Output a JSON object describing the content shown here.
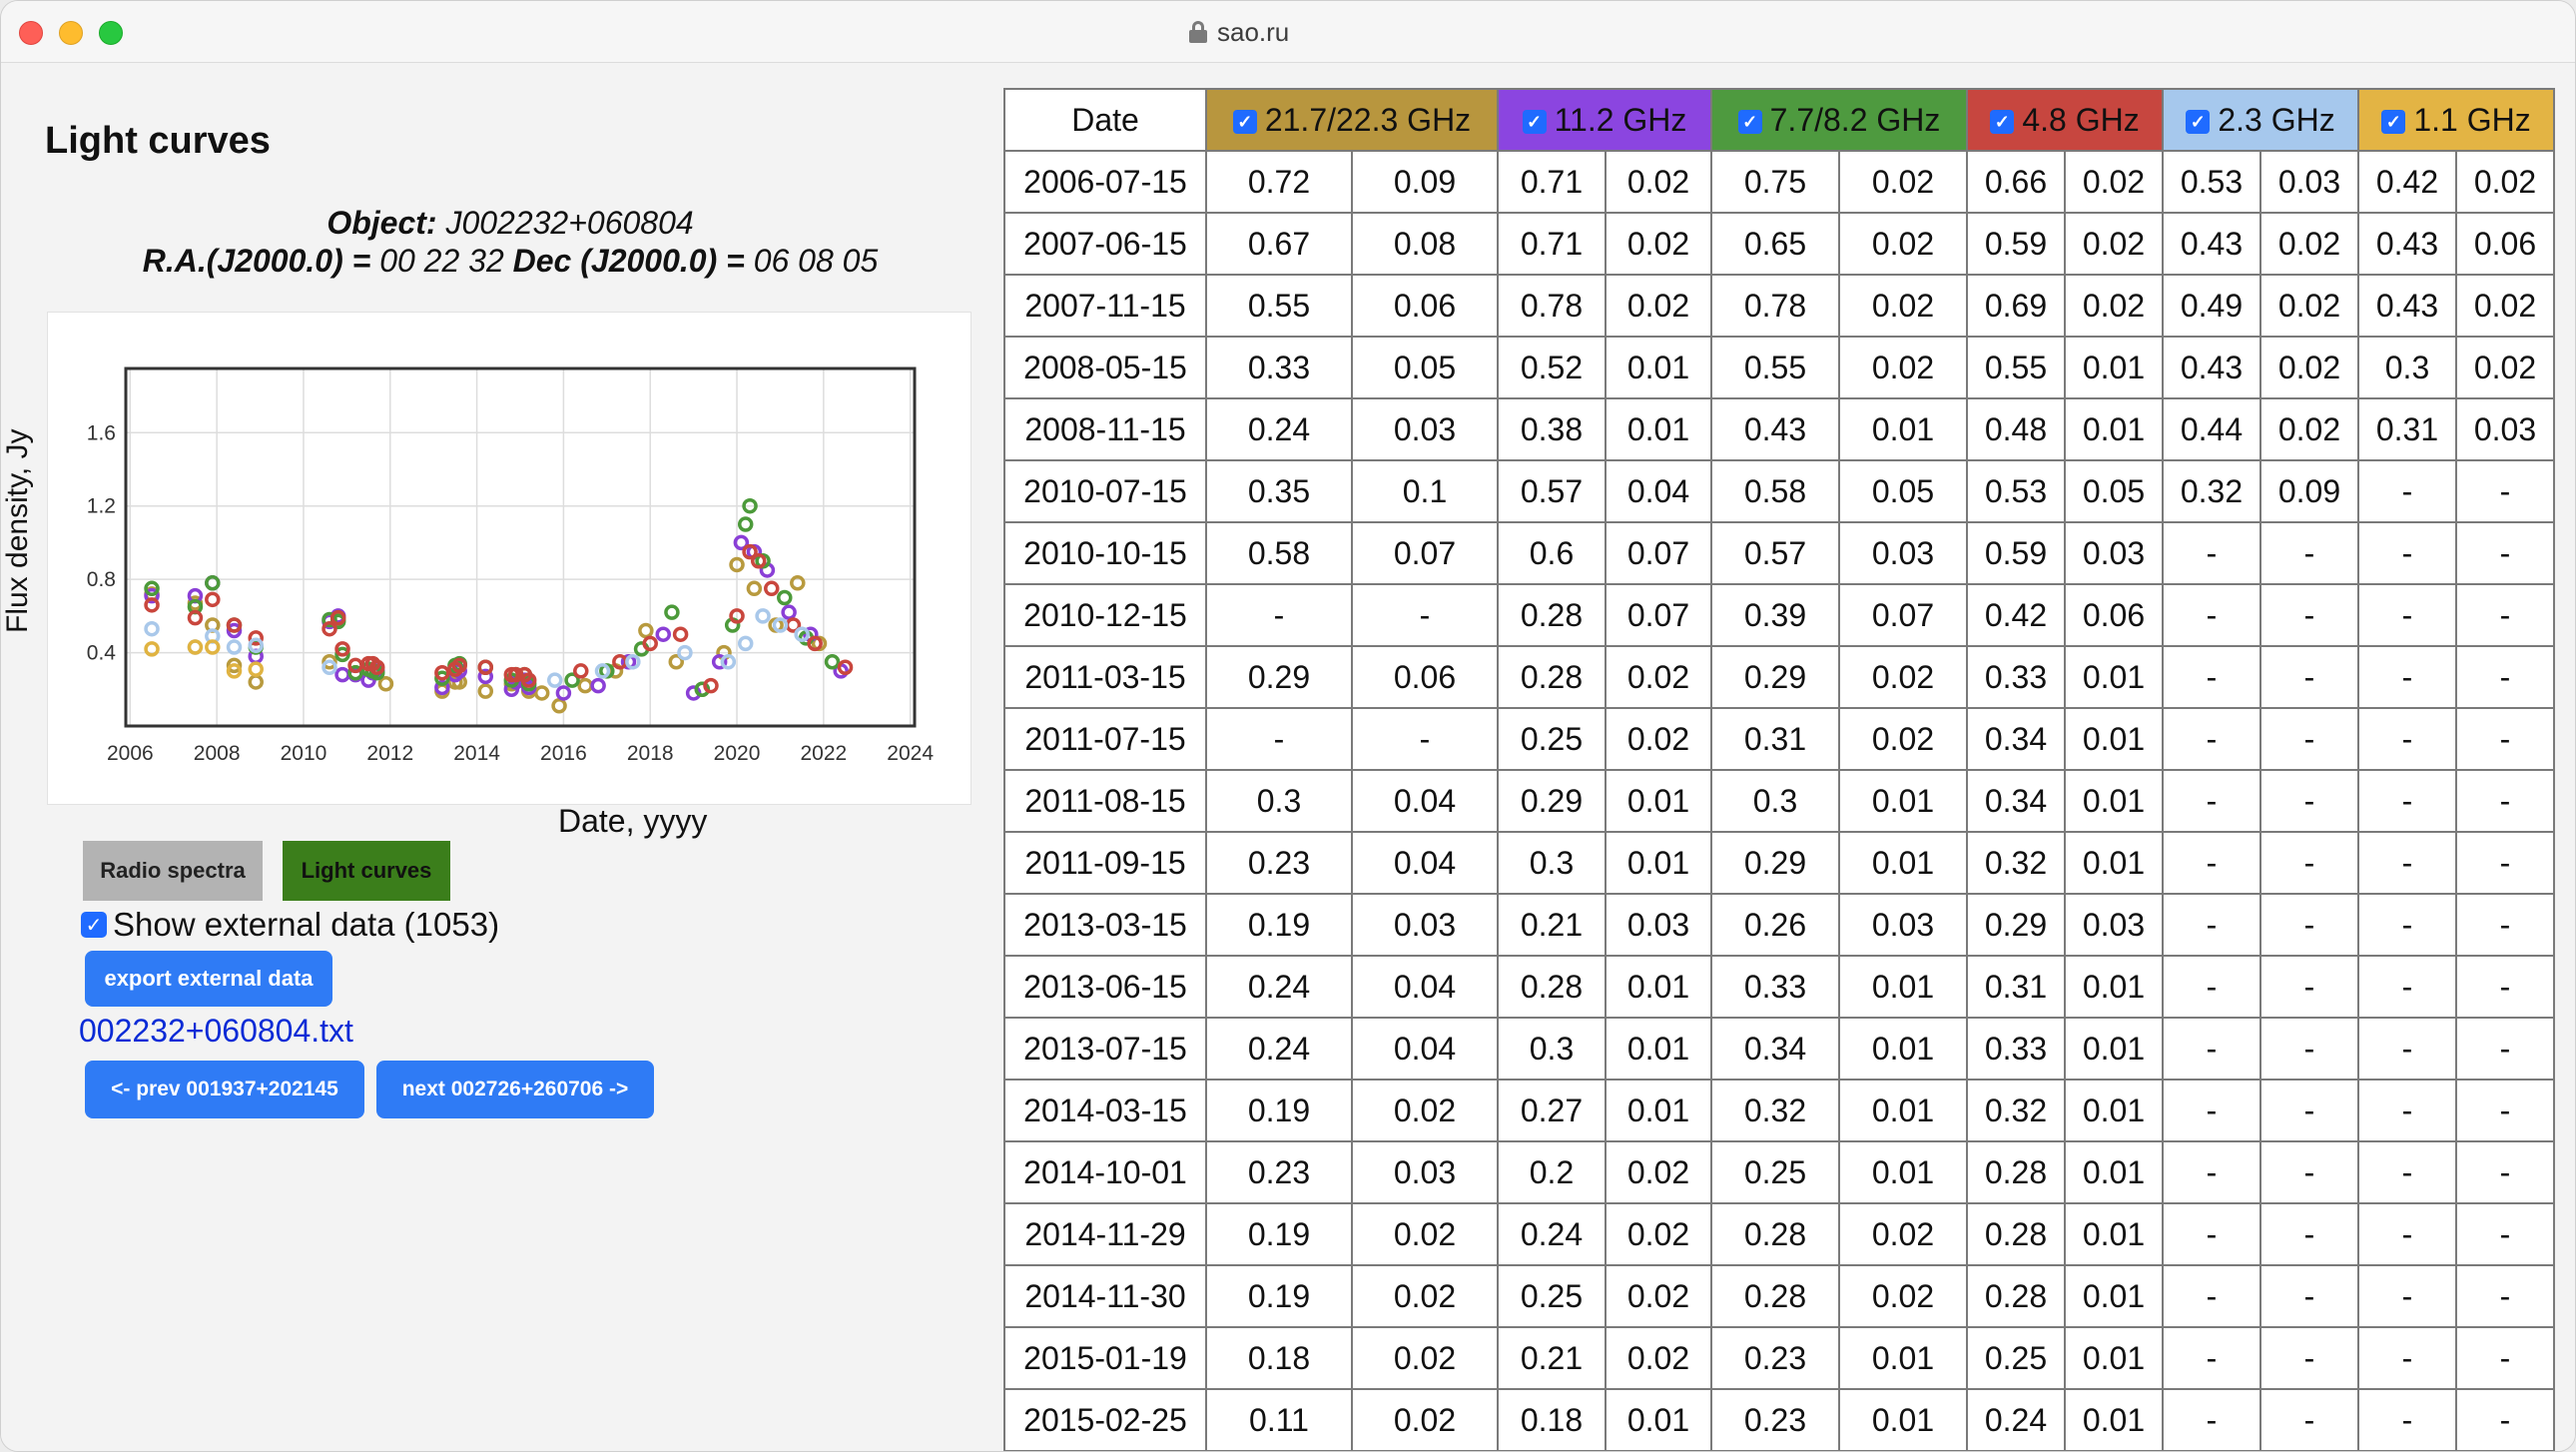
{
  "browser": {
    "url": "sao.ru"
  },
  "page": {
    "title": "Light curves",
    "object_label": "Object:",
    "object_name": "J002232+060804",
    "ra_label": "R.A.(J2000.0) =",
    "ra_value": "00 22 32",
    "dec_label": "Dec (J2000.0) =",
    "dec_value": "06 08 05"
  },
  "controls": {
    "radio_spectra": "Radio spectra",
    "light_curves": "Light curves",
    "show_external": "Show external data (1053)",
    "export": "export external data",
    "file_link": "002232+060804.txt",
    "prev": "<- prev 001937+202145",
    "next": "next 002726+260706 ->"
  },
  "chart_data": {
    "type": "scatter",
    "xlabel": "Date, yyyy",
    "ylabel": "Flux density, Jy",
    "xlim": [
      2005.9,
      2024.1
    ],
    "ylim": [
      0.0,
      1.95
    ],
    "xticks": [
      2006,
      2008,
      2010,
      2012,
      2014,
      2016,
      2018,
      2020,
      2022,
      2024
    ],
    "yticks": [
      0.4,
      0.8,
      1.2,
      1.6
    ],
    "grid": true,
    "series": [
      {
        "name": "21.7/22.3 GHz",
        "color": "#b89a3e",
        "x": [
          2006.5,
          2007.5,
          2007.9,
          2008.4,
          2008.9,
          2010.6,
          2010.8,
          2011.2,
          2011.6,
          2011.9,
          2013.2,
          2013.5,
          2013.6,
          2014.2,
          2014.8,
          2015.2,
          2015.5,
          2015.9,
          2016.5,
          2017.2,
          2017.9,
          2018.6,
          2019.2,
          2019.7,
          2020.0,
          2020.4,
          2020.9,
          2021.4,
          2021.9
        ],
        "y": [
          0.72,
          0.67,
          0.55,
          0.33,
          0.24,
          0.35,
          0.58,
          0.29,
          0.3,
          0.23,
          0.19,
          0.24,
          0.24,
          0.19,
          0.23,
          0.19,
          0.18,
          0.11,
          0.22,
          0.3,
          0.52,
          0.35,
          0.2,
          0.4,
          0.88,
          0.75,
          0.55,
          0.78,
          0.45
        ]
      },
      {
        "name": "11.2 GHz",
        "color": "#8a3fd6",
        "x": [
          2006.5,
          2007.5,
          2007.9,
          2008.4,
          2008.9,
          2010.6,
          2010.8,
          2010.9,
          2011.2,
          2011.5,
          2011.6,
          2011.7,
          2013.2,
          2013.5,
          2013.6,
          2014.2,
          2014.8,
          2014.9,
          2015.1,
          2015.2,
          2016.0,
          2016.8,
          2017.5,
          2018.3,
          2019.0,
          2019.6,
          2020.1,
          2020.4,
          2020.7,
          2021.2,
          2021.7,
          2022.4
        ],
        "y": [
          0.71,
          0.71,
          0.78,
          0.52,
          0.38,
          0.57,
          0.6,
          0.28,
          0.28,
          0.25,
          0.29,
          0.3,
          0.21,
          0.28,
          0.3,
          0.27,
          0.2,
          0.24,
          0.25,
          0.21,
          0.18,
          0.22,
          0.35,
          0.5,
          0.18,
          0.35,
          1.0,
          0.95,
          0.85,
          0.62,
          0.5,
          0.3
        ]
      },
      {
        "name": "7.7/8.2 GHz",
        "color": "#4c9a3a",
        "x": [
          2006.5,
          2007.5,
          2007.9,
          2008.4,
          2008.9,
          2010.6,
          2010.8,
          2010.9,
          2011.2,
          2011.5,
          2011.6,
          2011.7,
          2013.2,
          2013.5,
          2013.6,
          2014.2,
          2014.8,
          2014.9,
          2015.1,
          2015.2,
          2016.2,
          2017.0,
          2017.8,
          2018.5,
          2019.2,
          2019.9,
          2020.2,
          2020.3,
          2020.6,
          2021.1,
          2021.6,
          2022.2
        ],
        "y": [
          0.75,
          0.65,
          0.78,
          0.55,
          0.43,
          0.58,
          0.57,
          0.39,
          0.29,
          0.31,
          0.3,
          0.29,
          0.26,
          0.33,
          0.34,
          0.32,
          0.25,
          0.28,
          0.28,
          0.23,
          0.25,
          0.3,
          0.42,
          0.62,
          0.2,
          0.55,
          1.1,
          1.2,
          0.9,
          0.7,
          0.48,
          0.35
        ]
      },
      {
        "name": "4.8 GHz",
        "color": "#c9463d",
        "x": [
          2006.5,
          2007.5,
          2007.9,
          2008.4,
          2008.9,
          2010.6,
          2010.8,
          2010.9,
          2011.2,
          2011.5,
          2011.6,
          2011.7,
          2013.2,
          2013.5,
          2013.6,
          2014.2,
          2014.8,
          2014.9,
          2015.1,
          2015.2,
          2016.4,
          2017.3,
          2018.0,
          2018.7,
          2019.4,
          2020.0,
          2020.3,
          2020.5,
          2020.8,
          2021.3,
          2021.8,
          2022.5
        ],
        "y": [
          0.66,
          0.59,
          0.69,
          0.55,
          0.48,
          0.53,
          0.59,
          0.42,
          0.33,
          0.34,
          0.34,
          0.32,
          0.29,
          0.31,
          0.33,
          0.32,
          0.28,
          0.28,
          0.28,
          0.25,
          0.3,
          0.35,
          0.45,
          0.5,
          0.22,
          0.6,
          0.95,
          0.9,
          0.75,
          0.55,
          0.45,
          0.32
        ]
      },
      {
        "name": "2.3 GHz",
        "color": "#a9c8ea",
        "x": [
          2006.5,
          2007.5,
          2007.9,
          2008.4,
          2008.9,
          2010.6,
          2015.8,
          2016.9,
          2017.6,
          2018.8,
          2019.8,
          2020.2,
          2020.6,
          2021.0,
          2021.5
        ],
        "y": [
          0.53,
          0.43,
          0.49,
          0.43,
          0.44,
          0.32,
          0.25,
          0.3,
          0.35,
          0.4,
          0.35,
          0.45,
          0.6,
          0.55,
          0.5
        ]
      },
      {
        "name": "1.1 GHz",
        "color": "#e0b341",
        "x": [
          2006.5,
          2007.5,
          2007.9,
          2008.4,
          2008.9
        ],
        "y": [
          0.42,
          0.43,
          0.43,
          0.3,
          0.31
        ]
      }
    ]
  },
  "table": {
    "date_header": "Date",
    "bands": [
      {
        "label": "21.7/22.3 GHz",
        "color": "#b8963e"
      },
      {
        "label": "11.2 GHz",
        "color": "#8b45e0"
      },
      {
        "label": "7.7/8.2 GHz",
        "color": "#4e9a3f"
      },
      {
        "label": "4.8 GHz",
        "color": "#c7463f"
      },
      {
        "label": "2.3 GHz",
        "color": "#a6c8ed"
      },
      {
        "label": "1.1 GHz",
        "color": "#e3b444"
      }
    ],
    "rows": [
      [
        "2006-07-15",
        "0.72",
        "0.09",
        "0.71",
        "0.02",
        "0.75",
        "0.02",
        "0.66",
        "0.02",
        "0.53",
        "0.03",
        "0.42",
        "0.02"
      ],
      [
        "2007-06-15",
        "0.67",
        "0.08",
        "0.71",
        "0.02",
        "0.65",
        "0.02",
        "0.59",
        "0.02",
        "0.43",
        "0.02",
        "0.43",
        "0.06"
      ],
      [
        "2007-11-15",
        "0.55",
        "0.06",
        "0.78",
        "0.02",
        "0.78",
        "0.02",
        "0.69",
        "0.02",
        "0.49",
        "0.02",
        "0.43",
        "0.02"
      ],
      [
        "2008-05-15",
        "0.33",
        "0.05",
        "0.52",
        "0.01",
        "0.55",
        "0.02",
        "0.55",
        "0.01",
        "0.43",
        "0.02",
        "0.3",
        "0.02"
      ],
      [
        "2008-11-15",
        "0.24",
        "0.03",
        "0.38",
        "0.01",
        "0.43",
        "0.01",
        "0.48",
        "0.01",
        "0.44",
        "0.02",
        "0.31",
        "0.03"
      ],
      [
        "2010-07-15",
        "0.35",
        "0.1",
        "0.57",
        "0.04",
        "0.58",
        "0.05",
        "0.53",
        "0.05",
        "0.32",
        "0.09",
        "-",
        "-"
      ],
      [
        "2010-10-15",
        "0.58",
        "0.07",
        "0.6",
        "0.07",
        "0.57",
        "0.03",
        "0.59",
        "0.03",
        "-",
        "-",
        "-",
        "-"
      ],
      [
        "2010-12-15",
        "-",
        "-",
        "0.28",
        "0.07",
        "0.39",
        "0.07",
        "0.42",
        "0.06",
        "-",
        "-",
        "-",
        "-"
      ],
      [
        "2011-03-15",
        "0.29",
        "0.06",
        "0.28",
        "0.02",
        "0.29",
        "0.02",
        "0.33",
        "0.01",
        "-",
        "-",
        "-",
        "-"
      ],
      [
        "2011-07-15",
        "-",
        "-",
        "0.25",
        "0.02",
        "0.31",
        "0.02",
        "0.34",
        "0.01",
        "-",
        "-",
        "-",
        "-"
      ],
      [
        "2011-08-15",
        "0.3",
        "0.04",
        "0.29",
        "0.01",
        "0.3",
        "0.01",
        "0.34",
        "0.01",
        "-",
        "-",
        "-",
        "-"
      ],
      [
        "2011-09-15",
        "0.23",
        "0.04",
        "0.3",
        "0.01",
        "0.29",
        "0.01",
        "0.32",
        "0.01",
        "-",
        "-",
        "-",
        "-"
      ],
      [
        "2013-03-15",
        "0.19",
        "0.03",
        "0.21",
        "0.03",
        "0.26",
        "0.03",
        "0.29",
        "0.03",
        "-",
        "-",
        "-",
        "-"
      ],
      [
        "2013-06-15",
        "0.24",
        "0.04",
        "0.28",
        "0.01",
        "0.33",
        "0.01",
        "0.31",
        "0.01",
        "-",
        "-",
        "-",
        "-"
      ],
      [
        "2013-07-15",
        "0.24",
        "0.04",
        "0.3",
        "0.01",
        "0.34",
        "0.01",
        "0.33",
        "0.01",
        "-",
        "-",
        "-",
        "-"
      ],
      [
        "2014-03-15",
        "0.19",
        "0.02",
        "0.27",
        "0.01",
        "0.32",
        "0.01",
        "0.32",
        "0.01",
        "-",
        "-",
        "-",
        "-"
      ],
      [
        "2014-10-01",
        "0.23",
        "0.03",
        "0.2",
        "0.02",
        "0.25",
        "0.01",
        "0.28",
        "0.01",
        "-",
        "-",
        "-",
        "-"
      ],
      [
        "2014-11-29",
        "0.19",
        "0.02",
        "0.24",
        "0.02",
        "0.28",
        "0.02",
        "0.28",
        "0.01",
        "-",
        "-",
        "-",
        "-"
      ],
      [
        "2014-11-30",
        "0.19",
        "0.02",
        "0.25",
        "0.02",
        "0.28",
        "0.02",
        "0.28",
        "0.01",
        "-",
        "-",
        "-",
        "-"
      ],
      [
        "2015-01-19",
        "0.18",
        "0.02",
        "0.21",
        "0.02",
        "0.23",
        "0.01",
        "0.25",
        "0.01",
        "-",
        "-",
        "-",
        "-"
      ],
      [
        "2015-02-25",
        "0.11",
        "0.02",
        "0.18",
        "0.01",
        "0.23",
        "0.01",
        "0.24",
        "0.01",
        "-",
        "-",
        "-",
        "-"
      ]
    ]
  }
}
